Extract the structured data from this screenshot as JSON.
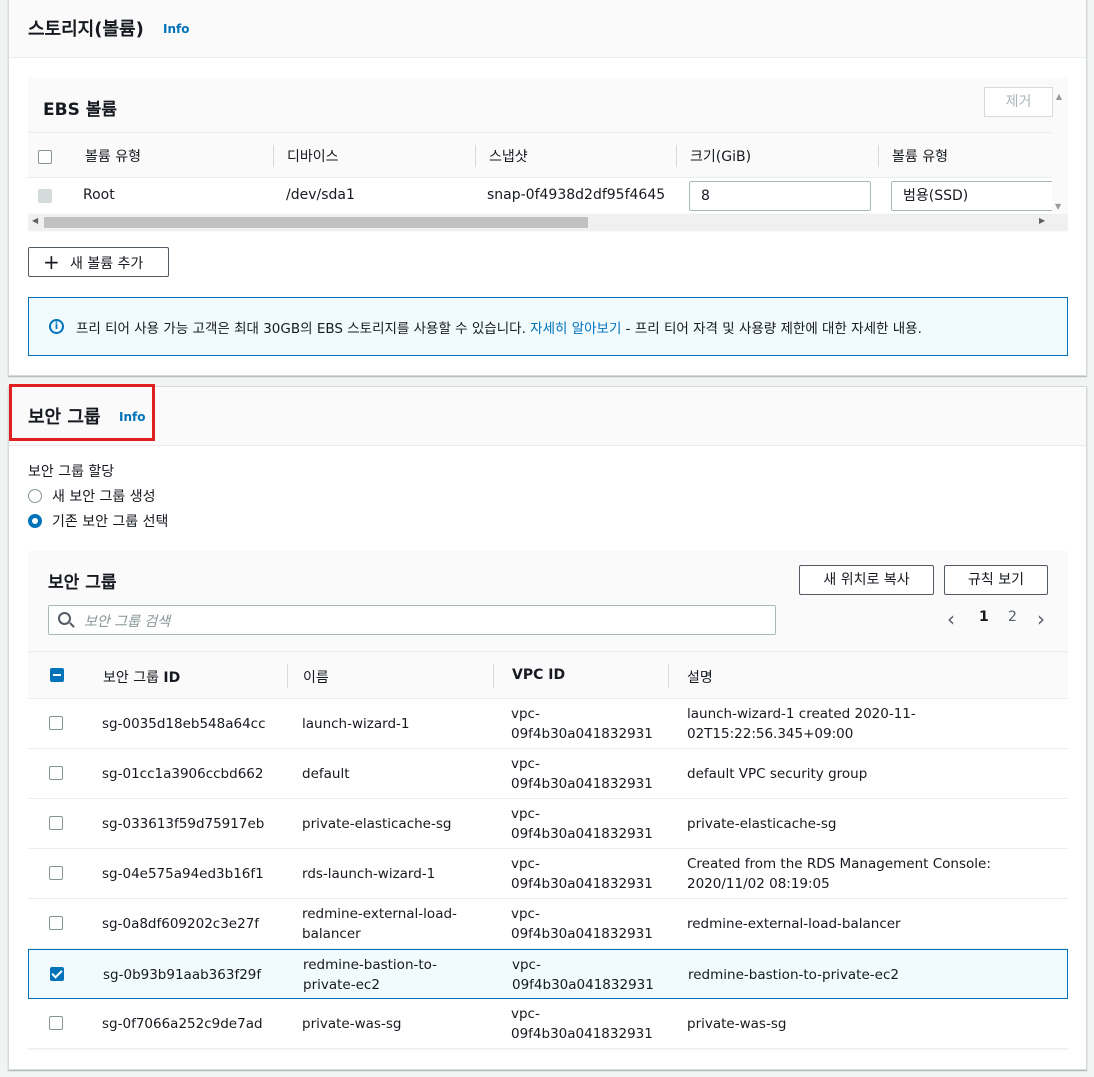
{
  "storage": {
    "title": "스토리지(볼륨)",
    "info": "Info",
    "ebs": {
      "title": "EBS 볼륨",
      "remove_button": "제거",
      "headers": [
        "볼륨 유형",
        "디바이스",
        "스냅샷",
        "크기(GiB)",
        "볼륨 유형"
      ],
      "row": {
        "volume_type": "Root",
        "device": "/dev/sda1",
        "snapshot": "snap-0f4938d2df95f4645",
        "size": "8",
        "type_select": "범용(SSD)"
      }
    },
    "add_volume_button": "새 볼륨 추가",
    "alert": {
      "text_before": "프리 티어 사용 가능 고객은 최대 30GB의 EBS 스토리지를 사용할 수 있습니다. ",
      "link": "자세히 알아보기",
      "text_after": " - 프리 티어 자격 및 사용량 제한에 대한 자세한 내용."
    }
  },
  "security_group": {
    "title": "보안 그룹",
    "info": "Info",
    "assign_label": "보안 그룹 할당",
    "options": [
      "새 보안 그룹 생성",
      "기존 보안 그룹 선택"
    ],
    "selected_option": 1,
    "table_title": "보안 그룹",
    "copy_button": "새 위치로 복사",
    "rules_button": "규칙 보기",
    "search_placeholder": "보안 그룹 검색",
    "pages": [
      "1",
      "2"
    ],
    "current_page": "1",
    "columns": {
      "id_prefix": "보안 그룹 ",
      "id_suffix": "ID",
      "name": "이름",
      "vpc": "VPC ID",
      "desc": "설명"
    },
    "rows": [
      {
        "id": "sg-0035d18eb548a64cc",
        "name": [
          "launch-wizard-1",
          ""
        ],
        "vpc": [
          "vpc-",
          "09f4b30a041832931"
        ],
        "desc": [
          "launch-wizard-1 created 2020-11-",
          "02T15:22:56.345+09:00"
        ],
        "checked": false
      },
      {
        "id": "sg-01cc1a3906ccbd662",
        "name": [
          "default",
          ""
        ],
        "vpc": [
          "vpc-",
          "09f4b30a041832931"
        ],
        "desc": [
          "default VPC security group",
          ""
        ],
        "checked": false
      },
      {
        "id": "sg-033613f59d75917eb",
        "name": [
          "private-elasticache-sg",
          ""
        ],
        "vpc": [
          "vpc-",
          "09f4b30a041832931"
        ],
        "desc": [
          "private-elasticache-sg",
          ""
        ],
        "checked": false
      },
      {
        "id": "sg-04e575a94ed3b16f1",
        "name": [
          "rds-launch-wizard-1",
          ""
        ],
        "vpc": [
          "vpc-",
          "09f4b30a041832931"
        ],
        "desc": [
          "Created from the RDS Management Console:",
          "2020/11/02 08:19:05"
        ],
        "checked": false
      },
      {
        "id": "sg-0a8df609202c3e27f",
        "name": [
          "redmine-external-load-",
          "balancer"
        ],
        "vpc": [
          "vpc-",
          "09f4b30a041832931"
        ],
        "desc": [
          "redmine-external-load-balancer",
          ""
        ],
        "checked": false
      },
      {
        "id": "sg-0b93b91aab363f29f",
        "name": [
          "redmine-bastion-to-",
          "private-ec2"
        ],
        "vpc": [
          "vpc-",
          "09f4b30a041832931"
        ],
        "desc": [
          "redmine-bastion-to-private-ec2",
          ""
        ],
        "checked": true
      },
      {
        "id": "sg-0f7066a252c9de7ad",
        "name": [
          "private-was-sg",
          ""
        ],
        "vpc": [
          "vpc-",
          "09f4b30a041832931"
        ],
        "desc": [
          "private-was-sg",
          ""
        ],
        "checked": false
      }
    ]
  },
  "colors": {
    "accent": "#0073bb",
    "highlight": "#e02020"
  }
}
